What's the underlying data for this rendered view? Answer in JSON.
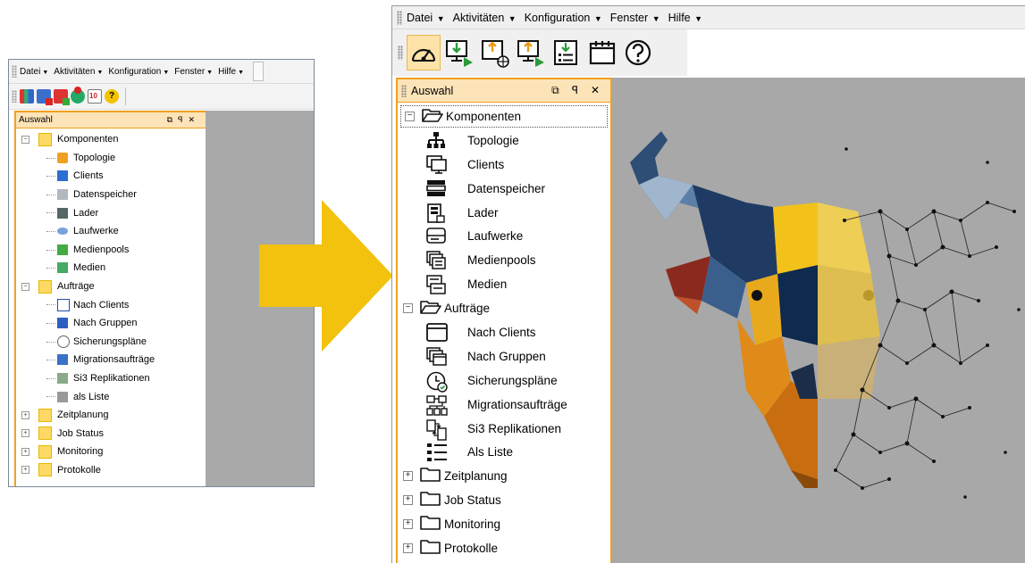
{
  "old_window": {
    "menu": [
      {
        "label": "Datei"
      },
      {
        "label": "Aktivitäten"
      },
      {
        "label": "Konfiguration"
      },
      {
        "label": "Fenster"
      },
      {
        "label": "Hilfe"
      }
    ],
    "panel_title": "Auswahl",
    "tree": {
      "komponenten": "Komponenten",
      "komponenten_items": [
        "Topologie",
        "Clients",
        "Datenspeicher",
        "Lader",
        "Laufwerke",
        "Medienpools",
        "Medien"
      ],
      "auftraege": "Aufträge",
      "auftraege_items": [
        "Nach Clients",
        "Nach Gruppen",
        "Sicherungspläne",
        "Migrationsaufträge",
        "Si3 Replikationen",
        "als Liste"
      ],
      "collapsed": [
        "Zeitplanung",
        "Job Status",
        "Monitoring",
        "Protokolle"
      ]
    }
  },
  "new_window": {
    "menu": [
      {
        "label": "Datei"
      },
      {
        "label": "Aktivitäten"
      },
      {
        "label": "Konfiguration"
      },
      {
        "label": "Fenster"
      },
      {
        "label": "Hilfe"
      }
    ],
    "toolbar_icons": [
      "dashboard-icon",
      "import-to-screen-icon",
      "export-network-icon",
      "upload-to-screen-icon",
      "list-import-icon",
      "calendar-icon",
      "help-icon"
    ],
    "panel_title": "Auswahl",
    "tree": {
      "komponenten": "Komponenten",
      "komponenten_items": [
        "Topologie",
        "Clients",
        "Datenspeicher",
        "Lader",
        "Laufwerke",
        "Medienpools",
        "Medien"
      ],
      "auftraege": "Aufträge",
      "auftraege_items": [
        "Nach Clients",
        "Nach Gruppen",
        "Sicherungspläne",
        "Migrationsaufträge",
        "Si3 Replikationen",
        "Als Liste"
      ],
      "collapsed": [
        "Zeitplanung",
        "Job Status",
        "Monitoring",
        "Protokolle"
      ]
    }
  },
  "colors": {
    "accent_orange": "#f0a020",
    "panel_header": "#fde4b8",
    "arrow_yellow": "#f2c20f",
    "workspace_gray": "#a8a8a8"
  }
}
